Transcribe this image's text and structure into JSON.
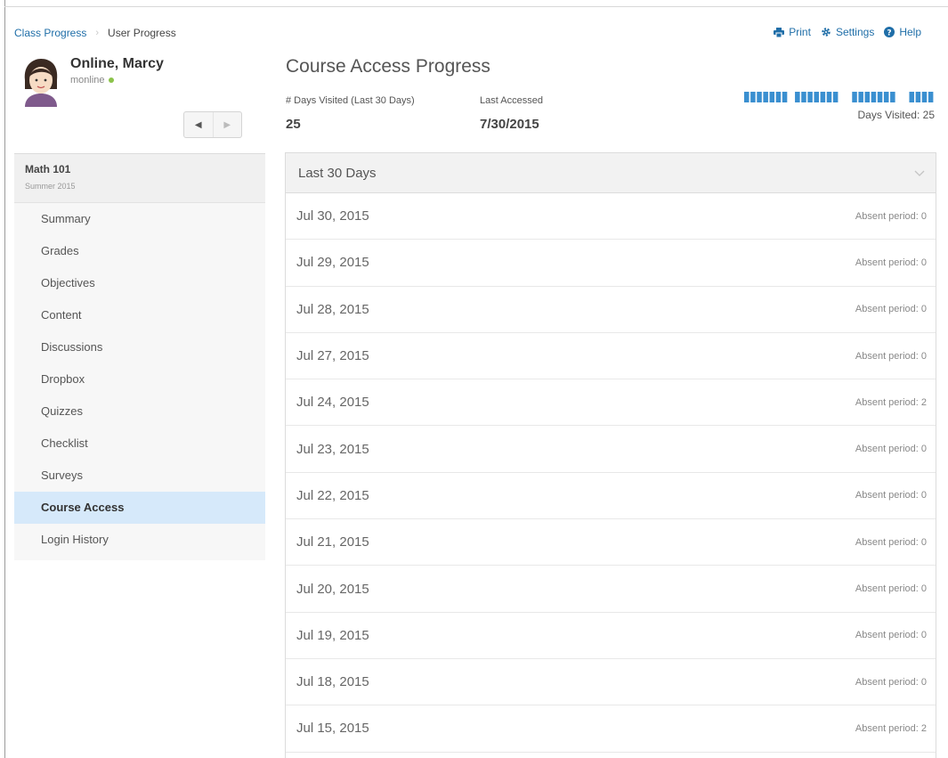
{
  "breadcrumb": {
    "parent": "Class Progress",
    "separator": "›",
    "current": "User Progress"
  },
  "actions": {
    "print": "Print",
    "settings": "Settings",
    "help": "Help"
  },
  "user": {
    "name": "Online, Marcy",
    "handle": "monline",
    "status": "online"
  },
  "pager": {
    "prev": "◀",
    "next": "▶"
  },
  "course": {
    "name": "Math 101",
    "term": "Summer 2015"
  },
  "nav": {
    "items": [
      {
        "label": "Summary"
      },
      {
        "label": "Grades"
      },
      {
        "label": "Objectives"
      },
      {
        "label": "Content"
      },
      {
        "label": "Discussions"
      },
      {
        "label": "Dropbox"
      },
      {
        "label": "Quizzes"
      },
      {
        "label": "Checklist"
      },
      {
        "label": "Surveys"
      },
      {
        "label": "Course Access",
        "active": true
      },
      {
        "label": "Login History"
      }
    ]
  },
  "main": {
    "title": "Course Access Progress",
    "days_visited_label": "# Days Visited (Last 30 Days)",
    "days_visited_value": "25",
    "last_accessed_label": "Last Accessed",
    "last_accessed_value": "7/30/2015",
    "sparkline_label": "Days Visited: 25",
    "sparkline_visits": [
      1,
      1,
      1,
      1,
      1,
      1,
      1,
      0,
      1,
      1,
      1,
      1,
      1,
      1,
      1,
      0,
      0,
      1,
      1,
      1,
      1,
      1,
      1,
      1,
      0,
      0,
      1,
      1,
      1,
      1
    ],
    "accent_color": "#3a8fd0"
  },
  "accordion": {
    "title": "Last 30 Days",
    "rows": [
      {
        "date": "Jul 30, 2015",
        "absent": "Absent period: 0"
      },
      {
        "date": "Jul 29, 2015",
        "absent": "Absent period: 0"
      },
      {
        "date": "Jul 28, 2015",
        "absent": "Absent period: 0"
      },
      {
        "date": "Jul 27, 2015",
        "absent": "Absent period: 0"
      },
      {
        "date": "Jul 24, 2015",
        "absent": "Absent period: 2"
      },
      {
        "date": "Jul 23, 2015",
        "absent": "Absent period: 0"
      },
      {
        "date": "Jul 22, 2015",
        "absent": "Absent period: 0"
      },
      {
        "date": "Jul 21, 2015",
        "absent": "Absent period: 0"
      },
      {
        "date": "Jul 20, 2015",
        "absent": "Absent period: 0"
      },
      {
        "date": "Jul 19, 2015",
        "absent": "Absent period: 0"
      },
      {
        "date": "Jul 18, 2015",
        "absent": "Absent period: 0"
      },
      {
        "date": "Jul 15, 2015",
        "absent": "Absent period: 2"
      }
    ]
  }
}
